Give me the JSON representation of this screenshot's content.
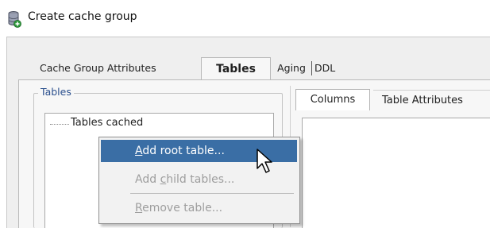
{
  "window": {
    "title": "Create cache group",
    "icon": "database-add-icon"
  },
  "tabs": [
    {
      "label": "Cache Group Attributes",
      "selected": false
    },
    {
      "label": "Tables",
      "selected": true
    },
    {
      "label": "Aging",
      "selected": false
    },
    {
      "label": "DDL",
      "selected": false
    }
  ],
  "tables_panel": {
    "group_label": "Tables",
    "tree_items": [
      "Tables cached"
    ]
  },
  "right_panel": {
    "subtabs": [
      {
        "label": "Columns",
        "selected": true
      },
      {
        "label": "Table Attributes",
        "selected": false
      }
    ]
  },
  "context_menu": {
    "items": [
      {
        "pre": "",
        "mnemonic": "A",
        "post": "dd root table...",
        "enabled": true,
        "highlighted": true
      },
      {
        "pre": "Add ",
        "mnemonic": "c",
        "post": "hild tables...",
        "enabled": false,
        "highlighted": false
      },
      {
        "pre": "",
        "mnemonic": "R",
        "post": "emove table...",
        "enabled": false,
        "highlighted": false
      }
    ]
  },
  "colors": {
    "menu_highlight": "#3a6ea5",
    "group_label": "#2a4f8d",
    "disabled_text": "#9e9e9e"
  }
}
